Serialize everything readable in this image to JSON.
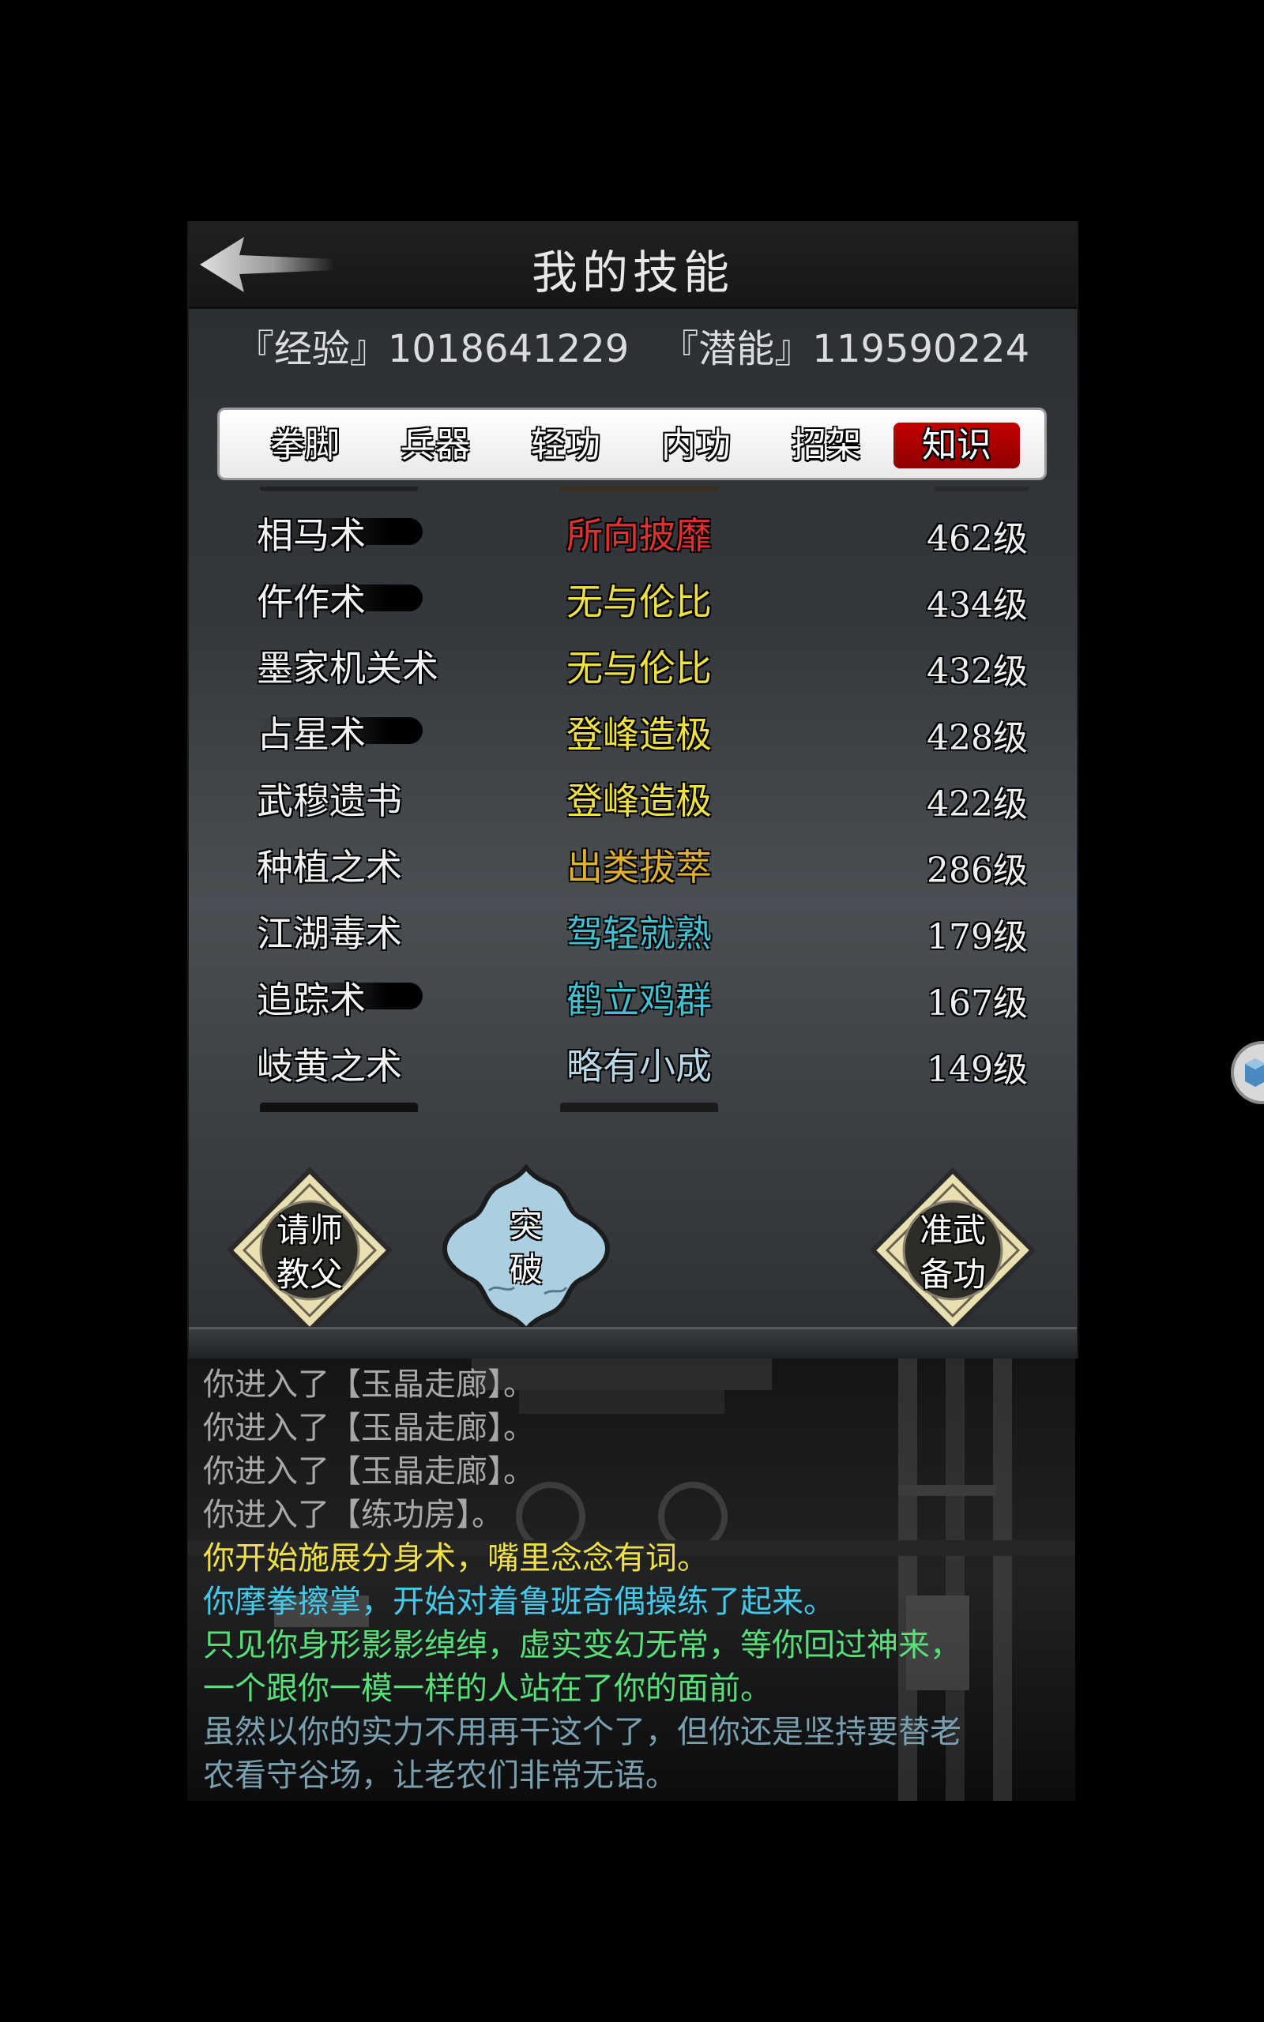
{
  "header": {
    "title": "我的技能"
  },
  "stats": {
    "exp_label": "『经验』",
    "exp_value": "1018641229",
    "potential_label": "『潜能』",
    "potential_value": "119590224"
  },
  "tabs": [
    {
      "label": "拳脚",
      "active": false
    },
    {
      "label": "兵器",
      "active": false
    },
    {
      "label": "轻功",
      "active": false
    },
    {
      "label": "内功",
      "active": false
    },
    {
      "label": "招架",
      "active": false
    },
    {
      "label": "知识",
      "active": true
    }
  ],
  "skills": [
    {
      "name": "相马术",
      "rank": "所向披靡",
      "rank_color": "#e03030",
      "level": "462级"
    },
    {
      "name": "仵作术",
      "rank": "无与伦比",
      "rank_color": "#f0e040",
      "level": "434级"
    },
    {
      "name": "墨家机关术",
      "rank": "无与伦比",
      "rank_color": "#f0e040",
      "level": "432级"
    },
    {
      "name": "占星术",
      "rank": "登峰造极",
      "rank_color": "#f0e040",
      "level": "428级"
    },
    {
      "name": "武穆遗书",
      "rank": "登峰造极",
      "rank_color": "#f0e040",
      "level": "422级"
    },
    {
      "name": "种植之术",
      "rank": "出类拔萃",
      "rank_color": "#e0b030",
      "level": "286级"
    },
    {
      "name": "江湖毒术",
      "rank": "驾轻就熟",
      "rank_color": "#40c0d0",
      "level": "179级"
    },
    {
      "name": "追踪术",
      "rank": "鹤立鸡群",
      "rank_color": "#40c0d0",
      "level": "167级"
    },
    {
      "name": "岐黄之术",
      "rank": "略有小成",
      "rank_color": "#b8d8e8",
      "level": "149级"
    }
  ],
  "actions": {
    "teacher_label_1": "请师",
    "teacher_label_2": "教父",
    "breakthrough_label_1": "突",
    "breakthrough_label_2": "破",
    "prepare_label_1": "准武",
    "prepare_label_2": "备功"
  },
  "log": [
    {
      "text": "你进入了【玉晶走廊】。",
      "color": "#a8a8a8"
    },
    {
      "text": "你进入了【玉晶走廊】。",
      "color": "#a8a8a8"
    },
    {
      "text": "你进入了【玉晶走廊】。",
      "color": "#a8a8a8"
    },
    {
      "text": "你进入了【练功房】。",
      "color": "#a8a8a8"
    },
    {
      "text": "你开始施展分身术，嘴里念念有词。",
      "color": "#f0e048"
    },
    {
      "text": "你摩拳擦掌，开始对着鲁班奇偶操练了起来。",
      "color": "#48c8e8"
    },
    {
      "text": "只见你身形影影绰绰，虚实变幻无常，等你回过神来，",
      "color": "#58e078"
    },
    {
      "text": "一个跟你一模一样的人站在了你的面前。",
      "color": "#58e078"
    },
    {
      "text": "虽然以你的实力不用再干这个了，但你还是坚持要替老",
      "color": "#7aa0b0"
    },
    {
      "text": "农看守谷场，让老农们非常无语。",
      "color": "#7aa0b0"
    }
  ],
  "colors": {
    "active_tab": "#c40000",
    "panel_bg": "#34383c"
  }
}
